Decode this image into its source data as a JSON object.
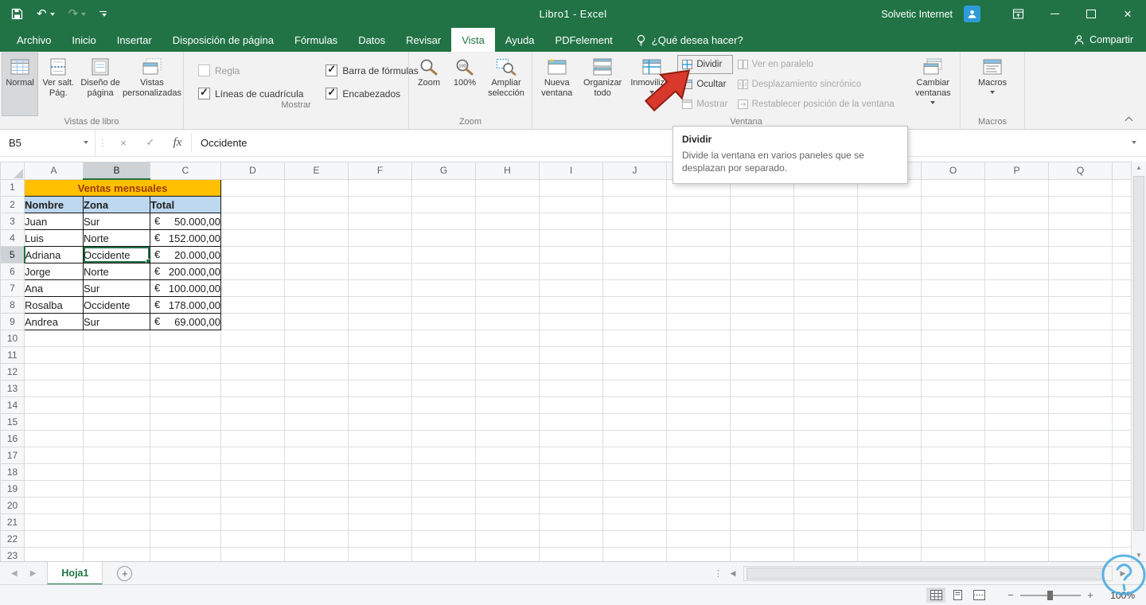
{
  "colors": {
    "excel_green": "#217346",
    "banner_bg": "#FFC000",
    "banner_text": "#9C3B00",
    "table_header_bg": "#BDD7EE",
    "selection": "#217346",
    "annotation_arrow": "#D8392C",
    "annotation_blue": "#41A8E0"
  },
  "titlebar": {
    "title": "Libro1 - Excel",
    "user": "Solvetic Internet"
  },
  "ribbon": {
    "tabs": [
      {
        "label": "Archivo",
        "active": false
      },
      {
        "label": "Inicio",
        "active": false
      },
      {
        "label": "Insertar",
        "active": false
      },
      {
        "label": "Disposición de página",
        "active": false
      },
      {
        "label": "Fórmulas",
        "active": false
      },
      {
        "label": "Datos",
        "active": false
      },
      {
        "label": "Revisar",
        "active": false
      },
      {
        "label": "Vista",
        "active": true
      },
      {
        "label": "Ayuda",
        "active": false
      },
      {
        "label": "PDFelement",
        "active": false
      }
    ],
    "tell_me": "¿Qué desea hacer?",
    "share": "Compartir",
    "groups": {
      "views": {
        "label": "Vistas de libro",
        "normal": "Normal",
        "page_break": "Ver salt. Pág.",
        "page_layout": "Diseño de página",
        "custom": "Vistas personalizadas"
      },
      "show": {
        "label": "Mostrar",
        "items": [
          {
            "label": "Regla",
            "checked": false,
            "disabled": true
          },
          {
            "label": "Barra de fórmulas",
            "checked": true,
            "disabled": false
          },
          {
            "label": "Líneas de cuadrícula",
            "checked": true,
            "disabled": false
          },
          {
            "label": "Encabezados",
            "checked": true,
            "disabled": false
          }
        ]
      },
      "zoom": {
        "label": "Zoom",
        "zoom": "Zoom",
        "hundred": "100%",
        "selection": "Ampliar selección"
      },
      "window": {
        "label": "Ventana",
        "new_window": "Nueva ventana",
        "arrange_all": "Organizar todo",
        "freeze": "Inmovilizar",
        "split": "Dividir",
        "hide": "Ocultar",
        "unhide": "Mostrar",
        "side_by_side": "Ver en paralelo",
        "sync_scroll": "Desplazamiento sincrónico",
        "reset_position": "Restablecer posición de la ventana",
        "switch_windows": "Cambiar ventanas"
      },
      "macros": {
        "label": "Macros",
        "button": "Macros"
      }
    }
  },
  "tooltip": {
    "title": "Dividir",
    "body": "Divide la ventana en varios paneles que se desplazan por separado."
  },
  "formula_bar": {
    "name_box": "B5",
    "value": "Occidente"
  },
  "sheet": {
    "columns": [
      "A",
      "B",
      "C",
      "D",
      "E",
      "F",
      "G",
      "H",
      "I",
      "J",
      "K",
      "L",
      "M",
      "N",
      "O",
      "P",
      "Q"
    ],
    "row_count": 24,
    "selected": {
      "col": "B",
      "row": 5
    },
    "banner": "Ventas mensuales",
    "table_headers": [
      "Nombre",
      "Zona",
      "Total"
    ],
    "currency": "€",
    "records": [
      {
        "nombre": "Juan",
        "zona": "Sur",
        "total": "50.000,00"
      },
      {
        "nombre": "Luis",
        "zona": "Norte",
        "total": "152.000,00"
      },
      {
        "nombre": "Adriana",
        "zona": "Occidente",
        "total": "20.000,00"
      },
      {
        "nombre": "Jorge",
        "zona": "Norte",
        "total": "200.000,00"
      },
      {
        "nombre": "Ana",
        "zona": "Sur",
        "total": "100.000,00"
      },
      {
        "nombre": "Rosalba",
        "zona": "Occidente",
        "total": "178.000,00"
      },
      {
        "nombre": "Andrea",
        "zona": "Sur",
        "total": "69.000,00"
      }
    ]
  },
  "sheet_tabs": {
    "active": "Hoja1"
  },
  "status_bar": {
    "zoom_level": "100%"
  }
}
